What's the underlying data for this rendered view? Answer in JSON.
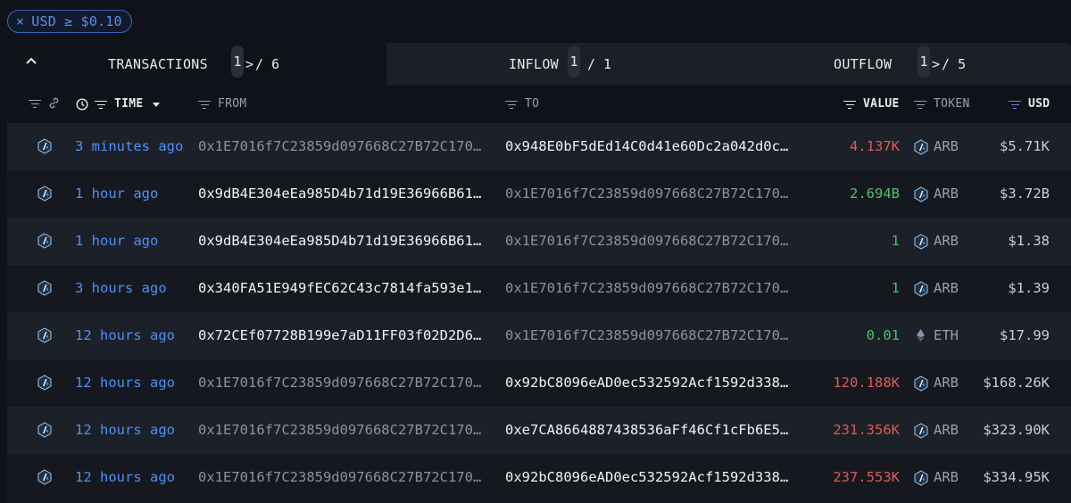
{
  "filter": {
    "close_icon": "×",
    "label": "USD ≥ $0.10"
  },
  "tabs": {
    "collapse_icon": "^",
    "transactions": {
      "label": "TRANSACTIONS",
      "page": "1",
      "total": "/ 6"
    },
    "inflow": {
      "label": "INFLOW",
      "page": "1",
      "total": "/ 1"
    },
    "outflow": {
      "label": "OUTFLOW",
      "page": "1",
      "total": "/ 5"
    },
    "arrow": ">"
  },
  "columns": {
    "time": "TIME",
    "from": "FROM",
    "to": "TO",
    "value": "VALUE",
    "token": "TOKEN",
    "usd": "USD"
  },
  "colors": {
    "link_blue": "#4f8ff7",
    "value_red": "#e05a55",
    "value_green": "#4fbf6a",
    "usd_filter_purple": "#8b6cf0"
  },
  "rows": [
    {
      "time": "3 minutes ago",
      "from": "0x1E7016f7C23859d097668C27B72C170…",
      "to": "0x948E0bF5dEd14C0d41e60Dc2a042d0c…",
      "value": "4.137K",
      "token": "ARB",
      "usd": "$5.71K"
    },
    {
      "time": "1 hour ago",
      "from": "0x9dB4E304eEa985D4b71d19E36966B61…",
      "to": "0x1E7016f7C23859d097668C27B72C170…",
      "value": "2.694B",
      "token": "ARB",
      "usd": "$3.72B"
    },
    {
      "time": "1 hour ago",
      "from": "0x9dB4E304eEa985D4b71d19E36966B61…",
      "to": "0x1E7016f7C23859d097668C27B72C170…",
      "value": "1",
      "token": "ARB",
      "usd": "$1.38"
    },
    {
      "time": "3 hours ago",
      "from": "0x340FA51E949fEC62C43c7814fa593e1…",
      "to": "0x1E7016f7C23859d097668C27B72C170…",
      "value": "1",
      "token": "ARB",
      "usd": "$1.39"
    },
    {
      "time": "12 hours ago",
      "from": "0x72CEf07728B199e7aD11FF03f02D2D6…",
      "to": "0x1E7016f7C23859d097668C27B72C170…",
      "value": "0.01",
      "token": "ETH",
      "usd": "$17.99"
    },
    {
      "time": "12 hours ago",
      "from": "0x1E7016f7C23859d097668C27B72C170…",
      "to": "0x92bC8096eAD0ec532592Acf1592d338…",
      "value": "120.188K",
      "token": "ARB",
      "usd": "$168.26K"
    },
    {
      "time": "12 hours ago",
      "from": "0x1E7016f7C23859d097668C27B72C170…",
      "to": "0xe7CA8664887438536aFf46Cf1cFb6E5…",
      "value": "231.356K",
      "token": "ARB",
      "usd": "$323.90K"
    },
    {
      "time": "12 hours ago",
      "from": "0x1E7016f7C23859d097668C27B72C170…",
      "to": "0x92bC8096eAD0ec532592Acf1592d338…",
      "value": "237.553K",
      "token": "ARB",
      "usd": "$334.95K"
    }
  ]
}
